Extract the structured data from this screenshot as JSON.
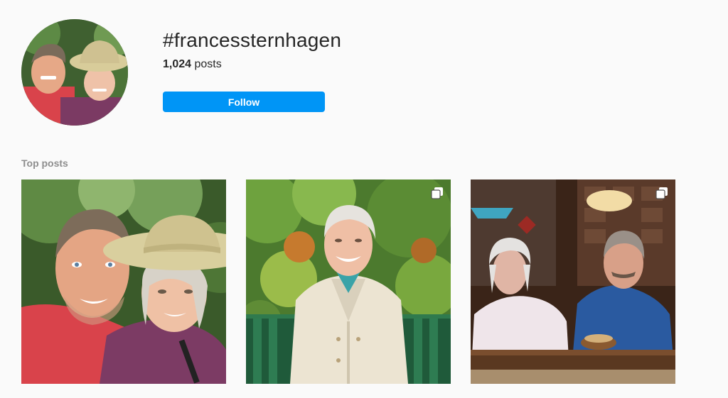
{
  "header": {
    "hashtag": "#francessternhagen",
    "posts_count": "1,024",
    "posts_suffix": " posts",
    "follow_label": "Follow"
  },
  "top_posts": {
    "title": "Top posts",
    "items": [
      {
        "description_icon": "none"
      },
      {
        "description_icon": "multiple-images-icon"
      },
      {
        "description_icon": "multiple-images-icon"
      }
    ]
  },
  "colors": {
    "background": "#fafafa",
    "follow_button": "#0095f6",
    "section_title": "#8e8e8e",
    "text": "#262626"
  }
}
